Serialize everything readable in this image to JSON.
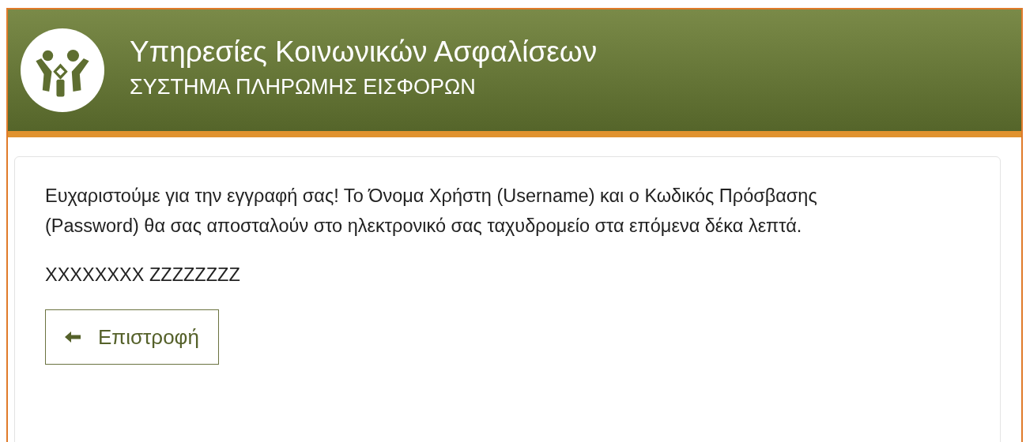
{
  "header": {
    "title": "Υπηρεσίες Κοινωνικών Ασφαλίσεων",
    "subtitle": "ΣΥΣΤΗΜΑ ΠΛΗΡΩΜΗΣ ΕΙΣΦΟΡΩΝ"
  },
  "message": {
    "text": "Ευχαριστούμε για την εγγραφή σας! Το Όνομα Χρήστη (Username) και ο Κωδικός Πρόσβασης (Password) θα σας αποσταλούν στο ηλεκτρονικό σας ταχυδρομείο στα επόμενα δέκα λεπτά.",
    "name": "XXXXXXXX ZZZZZZZZ"
  },
  "buttons": [
    {
      "kind": "back",
      "label": "Επιστροφή"
    }
  ]
}
